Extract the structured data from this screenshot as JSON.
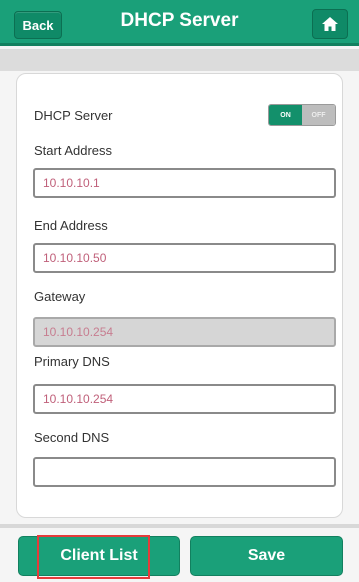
{
  "header": {
    "title": "DHCP Server",
    "back_label": "Back",
    "home_icon": "home-icon"
  },
  "form": {
    "dhcp_label": "DHCP Server",
    "toggle": {
      "on_label": "ON",
      "off_label": "OFF",
      "state": "on"
    },
    "start_address": {
      "label": "Start Address",
      "value": "10.10.10.1"
    },
    "end_address": {
      "label": "End Address",
      "value": "10.10.10.50"
    },
    "gateway": {
      "label": "Gateway",
      "value": "10.10.10.254"
    },
    "primary_dns": {
      "label": "Primary DNS",
      "value": "10.10.10.254"
    },
    "second_dns": {
      "label": "Second DNS",
      "value": ""
    }
  },
  "footer": {
    "client_list_label": "Client List",
    "save_label": "Save"
  },
  "colors": {
    "accent": "#1aa079",
    "field_text": "#c0607a",
    "highlight": "#e53b3b"
  }
}
